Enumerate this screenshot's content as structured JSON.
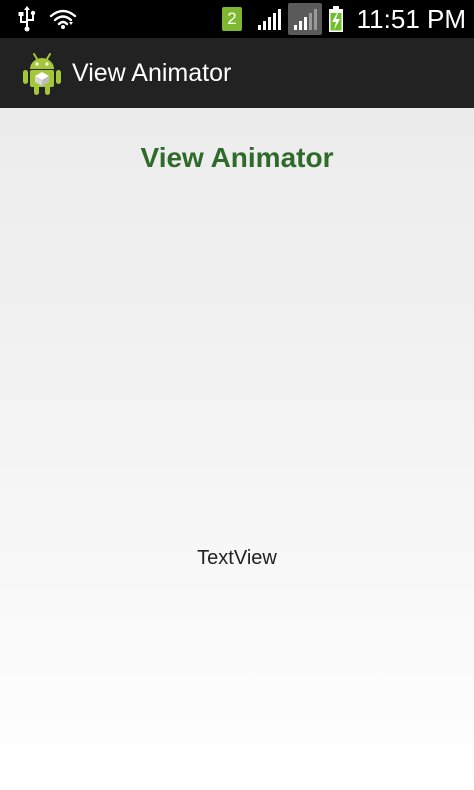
{
  "status_bar": {
    "time": "11:51 PM",
    "notification_count": "2",
    "icons": [
      "usb-icon",
      "wifi-icon",
      "notification-icon",
      "signal-icon",
      "signal-icon-2",
      "battery-charging-icon"
    ]
  },
  "action_bar": {
    "app_icon": "android-robot-icon",
    "title": "View Animator"
  },
  "content": {
    "heading": "View Animator",
    "text_view": "TextView"
  },
  "colors": {
    "status_bar": "#000000",
    "action_bar": "#222222",
    "heading": "#2e6b2b",
    "android_green": "#a4c639"
  }
}
